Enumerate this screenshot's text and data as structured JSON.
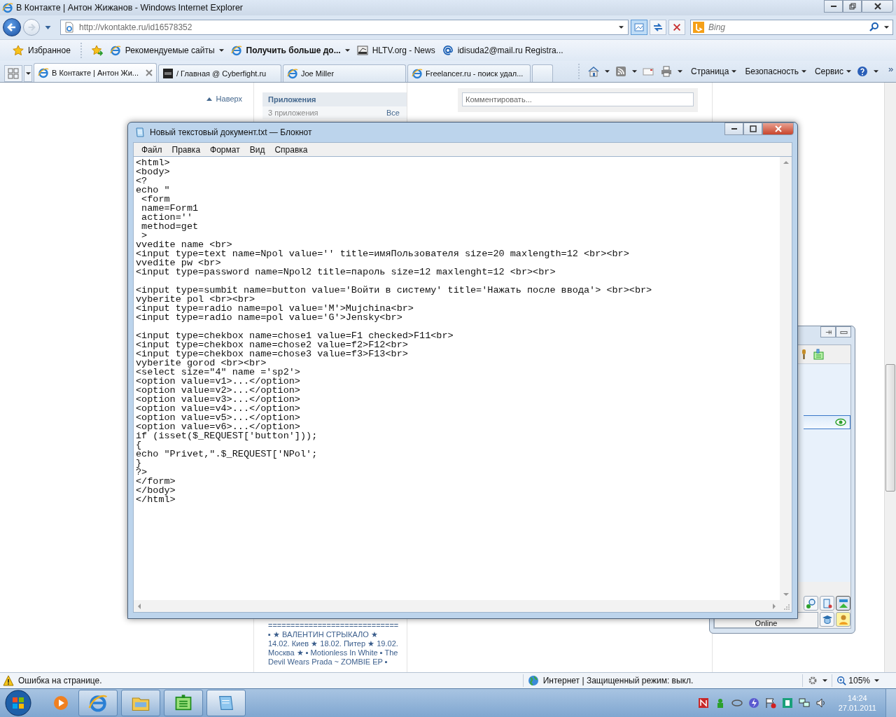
{
  "browser": {
    "title": "В Контакте | Антон Жижанов - Windows Internet Explorer",
    "address": "http://vkontakte.ru/id16578352",
    "search_placeholder": "Bing",
    "favorites": [
      {
        "label": "Избранное",
        "kind": "star"
      },
      {
        "label": "Рекомендуемые сайты",
        "kind": "menu"
      },
      {
        "label": "Получить больше до...",
        "kind": "bold-menu"
      },
      {
        "label": "HLTV.org - News",
        "kind": "site"
      },
      {
        "label": "idisuda2@mail.ru Registra...",
        "kind": "mail"
      }
    ],
    "tabs": [
      {
        "label": "В Контакте | Антон Жи...",
        "selected": true
      },
      {
        "label": "/ Главная @ Cyberfight.ru",
        "selected": false
      },
      {
        "label": "Joe Miller",
        "selected": false
      },
      {
        "label": "Freelancer.ru - поиск удал...",
        "selected": false
      }
    ],
    "commands": [
      "Страница",
      "Безопасность",
      "Сервис"
    ],
    "more": "»",
    "page": {
      "back_to_top": "Наверх",
      "apps_heading": "Приложения",
      "apps_count": "3 приложения",
      "apps_all": "Все",
      "comment_placeholder": "Комментировать...",
      "news_rule": "=============================",
      "news_text": "▪ ★ ВАЛЕНТИН СТРЫКАЛО ★ 14.02. Киев ★ 18.02. Питер ★ 19.02. Москва ★ ▪ Motionless In White ▪ The Devil Wears Prada ~ ZOMBIE EP ▪"
    },
    "status": {
      "error": "Ошибка на странице.",
      "zone": "Интернет | Защищенный режим: выкл.",
      "zoom": "105%"
    }
  },
  "notepad": {
    "title": "Новый текстовый документ.txt — Блокнот",
    "menu": [
      "Файл",
      "Правка",
      "Формат",
      "Вид",
      "Справка"
    ],
    "text": "<html>\n<body>\n<?\necho \"\n <form\n name=Form1\n action=''\n method=get\n >\nvvedite name <br>\n<input type=text name=Npol value='' title=имяПользователя size=20 maxlength=12 <br><br>\nvvedite pw <br>\n<input type=password name=Npol2 title=пароль size=12 maxlenght=12 <br><br>\n\n<input type=sumbit name=button value='Войти в систему' title='Нажать после ввода'> <br><br>\nvyberite pol <br><br>\n<input type=radio name=pol value='M'>Mujchina<br>\n<input type=radio name=pol value='G'>Jensky<br>\n\n<input type=chekbox name=chose1 value=F1 checked>F11<br>\n<input type=chekbox name=chose2 value=f2>F12<br>\n<input type=chekbox name=chose3 value=f3>F13<br>\nvyberite gorod <br><br>\n<select size=\"4\" name ='sp2'>\n<option value=v1>...</option>\n<option value=v2>...</option>\n<option value=v3>...</option>\n<option value=v4>...</option>\n<option value=v5>...</option>\n<option value=v6>...</option>\nif (isset($_REQUEST['button']));\n{\necho \"Privet,\".$_REQUEST['NPol';\n}\n?>\n</form>\n</body>\n</html>"
  },
  "messenger": {
    "status": "Online"
  },
  "taskbar": {
    "time": "14:24",
    "date": "27.01.2011"
  }
}
